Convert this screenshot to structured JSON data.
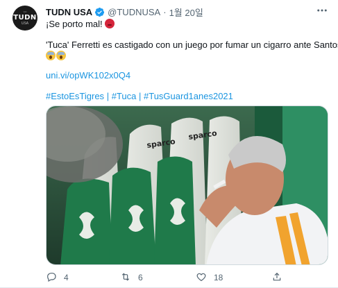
{
  "account": {
    "name": "TUDN USA",
    "handle": "@TUDNUSA",
    "separator": "·",
    "date": "1월 20일",
    "avatar_text": "TUDN",
    "avatar_sub": "USA"
  },
  "tweet": {
    "line1": "¡Se porto mal!",
    "line2": "'Tuca' Ferretti es castigado con un juego por fumar un cigarro ante Santos",
    "link": "uni.vi/opWK102x0Q4",
    "hashtags": [
      "#EstoEsTigres",
      "|",
      "#Tuca",
      "|",
      "#TusGuard1anes2021"
    ]
  },
  "media": {
    "sponsor_text": "sparco"
  },
  "actions": {
    "reply_count": "4",
    "retweet_count": "6",
    "like_count": "18"
  },
  "colors": {
    "link": "#1b95e0",
    "secondary": "#536471",
    "verified": "#1d9bf0",
    "seat_green": "#1f7a4a"
  },
  "icons": {
    "verified": "verified-badge-icon",
    "more": "more-icon",
    "reply": "reply-icon",
    "retweet": "retweet-icon",
    "like": "heart-icon",
    "share": "share-icon"
  }
}
